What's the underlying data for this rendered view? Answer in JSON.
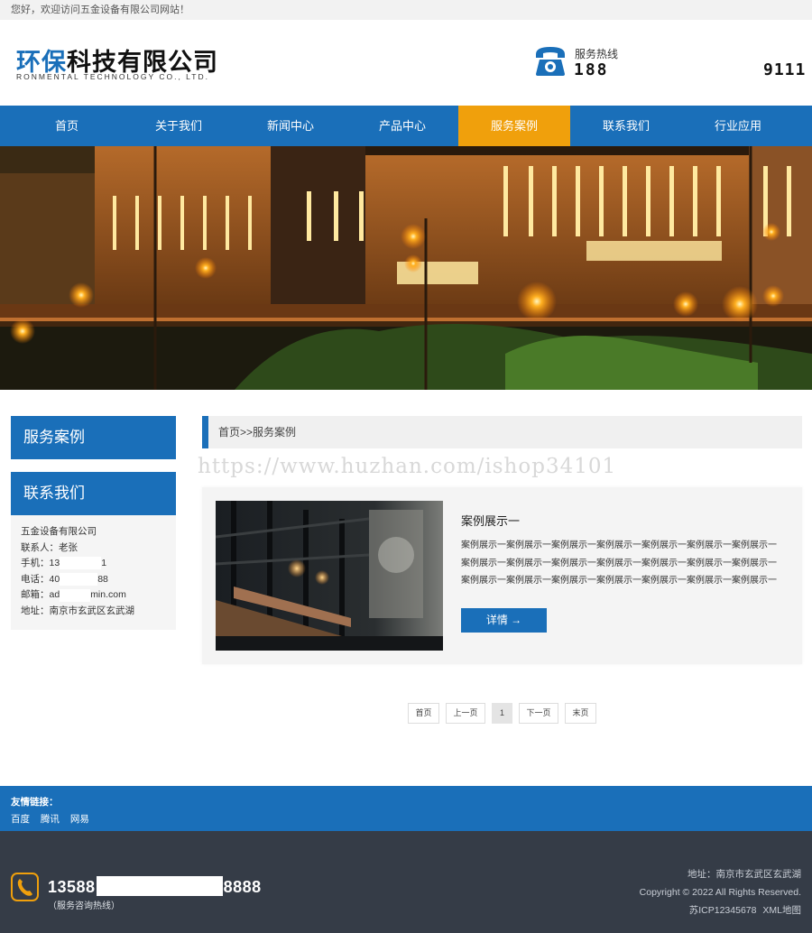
{
  "topbar": {
    "welcome": "您好，欢迎访问五金设备有限公司网站！"
  },
  "header": {
    "logo_blue": "环保",
    "logo_black": "科技有限公司",
    "logo_sub": "RONMENTAL TECHNOLOGY CO., LTD.",
    "hotline_label": "服务热线",
    "hotline_part1": "188",
    "hotline_part2": "9111"
  },
  "nav": {
    "items": [
      "首页",
      "关于我们",
      "新闻中心",
      "产品中心",
      "服务案例",
      "联系我们",
      "行业应用"
    ],
    "active_index": 4
  },
  "sidebar": {
    "title1": "服务案例",
    "title2": "联系我们",
    "contact": {
      "company": "五金设备有限公司",
      "person_label": "联系人：",
      "person": "老张",
      "mobile_label": "手机：",
      "mobile_start": "13",
      "mobile_end": "1",
      "phone_label": "电话：",
      "phone_start": "40",
      "phone_end": "88",
      "email_label": "邮箱：",
      "email_start": "ad",
      "email_end": "min.com",
      "address_label": "地址：",
      "address": "南京市玄武区玄武湖"
    }
  },
  "breadcrumb": {
    "text": "首页>>服务案例"
  },
  "watermark": "https://www.huzhan.com/ishop34101",
  "case": {
    "title": "案例展示一",
    "lines": [
      "案例展示一案例展示一案例展示一案例展示一案例展示一案例展示一案例展示一",
      "案例展示一案例展示一案例展示一案例展示一案例展示一案例展示一案例展示一",
      "案例展示一案例展示一案例展示一案例展示一案例展示一案例展示一案例展示一"
    ],
    "detail_button": "详情 →"
  },
  "pagination": {
    "first": "首页",
    "prev": "上一页",
    "current": "1",
    "next": "下一页",
    "last": "末页"
  },
  "friend_links": {
    "title": "友情链接：",
    "items": [
      "百度",
      "腾讯",
      "网易"
    ]
  },
  "footer": {
    "phone_start": "13588",
    "phone_end": "8888",
    "phone_label": "（服务咨询热线）",
    "address": "地址：南京市玄武区玄武湖",
    "copyright": "Copyright © 2022 All Rights Reserved.",
    "icp": "苏ICP12345678",
    "sitemap": "XML地图"
  },
  "colors": {
    "primary": "#1a6fb9",
    "accent": "#f0a00c",
    "footer_bg": "#353c47"
  }
}
